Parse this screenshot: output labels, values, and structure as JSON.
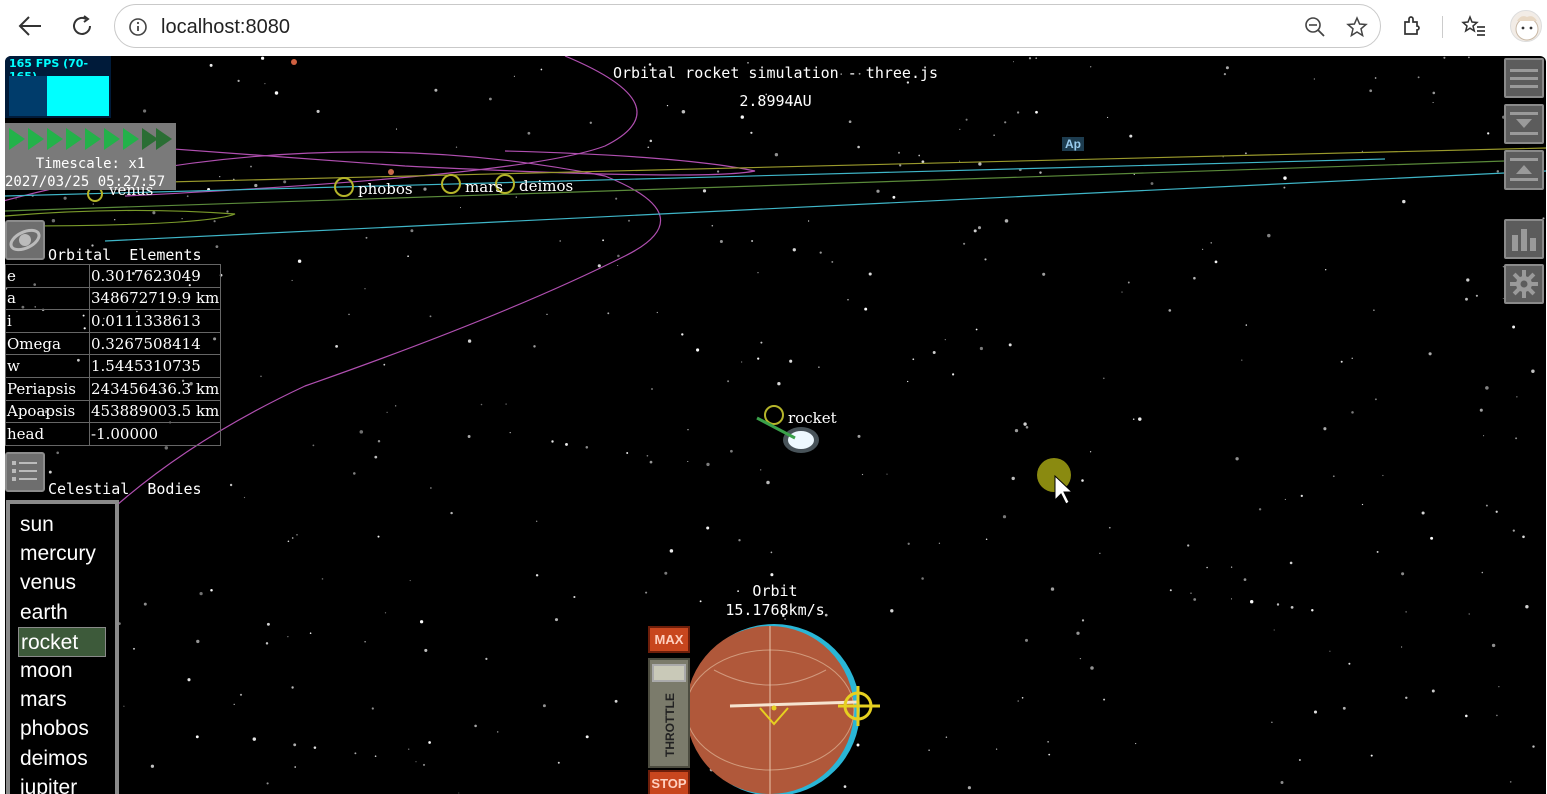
{
  "browser": {
    "url": "localhost:8080",
    "icons": [
      "back-icon",
      "reload-icon",
      "info-icon",
      "zoom-out-icon",
      "star-icon",
      "extensions-icon",
      "favorites-icon",
      "profile-avatar"
    ]
  },
  "stats": {
    "fps_label": "165 FPS (70-165)"
  },
  "sim": {
    "title": "Orbital rocket simulation - three.js",
    "distance": "2.8994AU",
    "timescale": "Timescale: x1",
    "datetime": "2027/03/25 05:27:57"
  },
  "orbital_elements": {
    "heading": "Orbital  Elements",
    "rows": [
      {
        "key": "e",
        "value": "0.3017623049"
      },
      {
        "key": "a",
        "value": "348672719.9 km"
      },
      {
        "key": "i",
        "value": "0.0111338613"
      },
      {
        "key": "Omega",
        "value": "0.3267508414"
      },
      {
        "key": "w",
        "value": "1.5445310735"
      },
      {
        "key": "Periapsis",
        "value": "243456436.3 km"
      },
      {
        "key": "Apoapsis",
        "value": "453889003.5 km"
      },
      {
        "key": "head",
        "value": "-1.00000"
      }
    ]
  },
  "celestial": {
    "heading": "Celestial  Bodies",
    "bodies": [
      "sun",
      "mercury",
      "venus",
      "earth",
      "rocket",
      "moon",
      "mars",
      "phobos",
      "deimos",
      "jupiter"
    ],
    "selected": "rocket"
  },
  "scene_labels": {
    "venus": "venus",
    "phobos": "phobos",
    "mars": "mars",
    "deimos": "deimos",
    "rocket": "rocket",
    "apoapsis_marker": "Ap"
  },
  "navball": {
    "mode": "Orbit",
    "speed": "15.1768km/s"
  },
  "throttle": {
    "max_label": "MAX",
    "stop_label": "STOP",
    "label": "THROTTLE"
  },
  "colors": {
    "orbit_magenta": "#b04fb0",
    "orbit_cyan": "#3fb6c8",
    "orbit_yellow": "#9a9a2c",
    "selected_bg": "#3d5a3a",
    "fps_cyan": "#00ffff",
    "throttle_red": "#c8461e"
  }
}
